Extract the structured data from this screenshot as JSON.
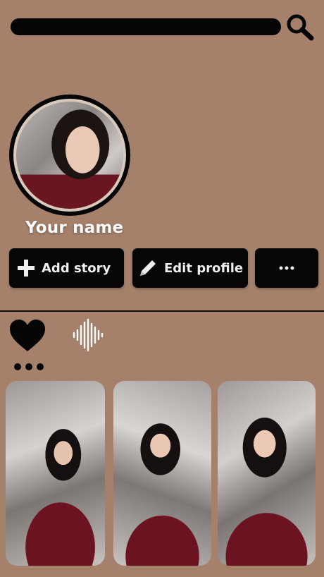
{
  "colors": {
    "background": "#a5806b",
    "button_bg": "#060606",
    "button_text": "#eeeeee",
    "name_text": "#ffffff",
    "dress": "#6b1321"
  },
  "search": {
    "icon": "search-icon"
  },
  "profile": {
    "name": "Your name",
    "avatar": "profile-photo"
  },
  "actions": {
    "add_story": {
      "label": "Add story",
      "icon": "plus-icon"
    },
    "edit_profile": {
      "label": "Edit profile",
      "icon": "pencil-icon"
    },
    "more": {
      "label": "···",
      "icon": "more-dots-icon"
    }
  },
  "feed": {
    "icons": [
      "heart-icon",
      "sound-wave-icon",
      "more-dots-icon"
    ],
    "photos": [
      {
        "name": "photo-1"
      },
      {
        "name": "photo-2"
      },
      {
        "name": "photo-3"
      }
    ]
  }
}
